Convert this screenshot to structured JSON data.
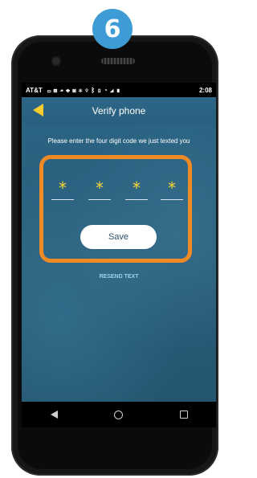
{
  "step_badge": "6",
  "status_bar": {
    "carrier": "AT&T",
    "icons": [
      "message-icon",
      "chat-icon",
      "cloud-icon",
      "plus-icon",
      "image-icon",
      "settings-icon",
      "location-icon",
      "bluetooth-icon",
      "vibrate-icon",
      "wifi-icon",
      "signal-icon",
      "battery-icon"
    ],
    "time": "2:08"
  },
  "app_bar": {
    "title": "Verify phone",
    "back_icon": "back-arrow-icon",
    "accent": "#f6cc2e"
  },
  "verification": {
    "instruction": "Please enter the four digit code we just texted you",
    "digits": [
      "*",
      "*",
      "*",
      "*"
    ],
    "highlight_color": "#f28b23"
  },
  "actions": {
    "save_label": "Save",
    "resend_label": "RESEND TEXT"
  },
  "nav_bar": {
    "buttons": [
      "back-icon",
      "home-icon",
      "recent-apps-icon"
    ]
  }
}
